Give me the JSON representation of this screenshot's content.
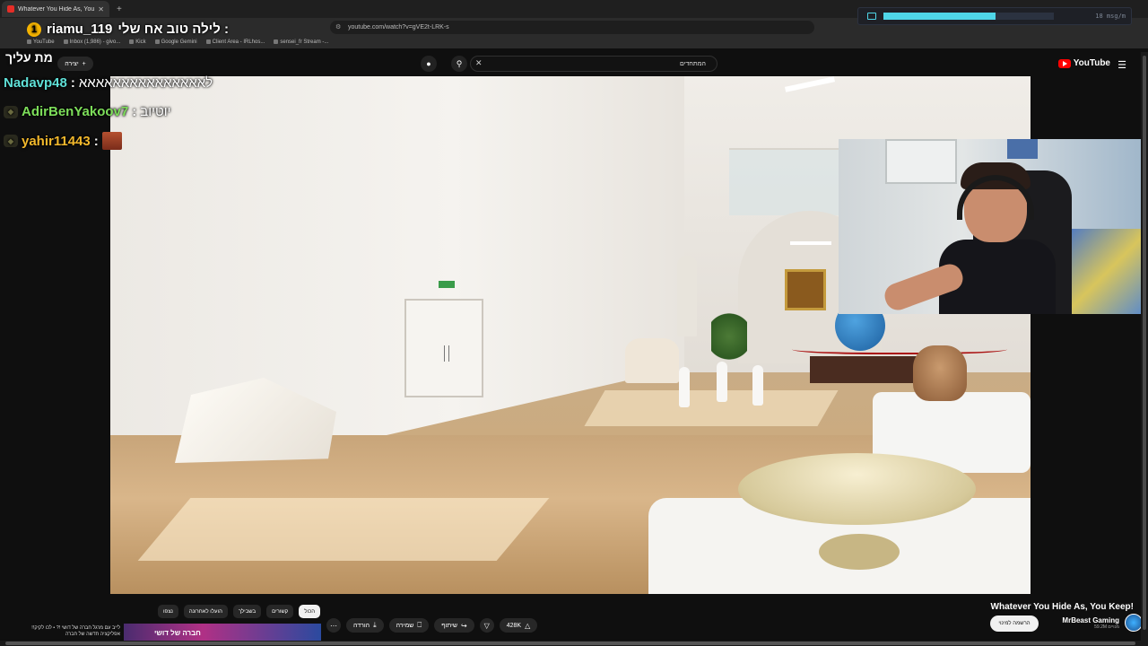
{
  "browser": {
    "tab_title": "Whatever You Hide As, You K",
    "url": "youtube.com/watch?v=gVE2t-LRK-s",
    "bookmarks": [
      "YouTube",
      "Inbox (1,986) - givo...",
      "Kick",
      "Google Gemini",
      "Client Area - IRLhos...",
      "sensei_fr Stream -..."
    ]
  },
  "meter": {
    "label": "18 msg/m",
    "level_fraction": 0.66,
    "accent": "#4fd6e8"
  },
  "youtube": {
    "logo_text": "YouTube",
    "search_value": "המתחדים",
    "create_label": "יצירה",
    "video_title": "Whatever You Hide As, You Keep!",
    "channel_name": "MrBeast Gaming",
    "channel_subs": "59.2M מנויים",
    "subscribe_label": "הרשמה למינוי",
    "likes": "428K",
    "share_label": "שיתוף",
    "save_label": "שמירה",
    "download_label": "הורדה",
    "chips": [
      "הכול",
      "קשורים",
      "בשבילך",
      "הועלו לאחרונה",
      "נצפו"
    ],
    "rec_text": "לייב עם מרגל חברה של דושי !? • לכו לקיק!! אפליקציה חדשה של חברה",
    "rec_thumb_text": "חברה של דושי"
  },
  "chat": {
    "header_user": "riamu_119",
    "header_msg": "לילה טוב אח שלי :",
    "header_badge": "1",
    "corner_text": "מת עליך",
    "lines": [
      {
        "user": "Nadavp48",
        "color": "#5fe0d7",
        "msg": "לאאאאאאאאאאאאאאא"
      },
      {
        "user": "AdirBenYakoov7",
        "color": "#7dde5a",
        "msg": "יוטיוב"
      },
      {
        "user": "yahir11443",
        "color": "#f2b82c",
        "msg": ""
      }
    ]
  },
  "colors": {
    "accent": "#ff0000",
    "bg": "#0f0f0f"
  }
}
